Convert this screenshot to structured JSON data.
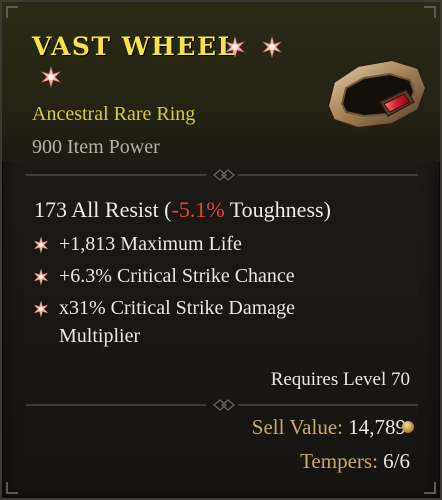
{
  "item": {
    "name": "VAST WHEEL",
    "type": "Ancestral Rare Ring",
    "item_power": "900 Item Power",
    "icon": "ring-icon"
  },
  "stats": {
    "resist_prefix": "173 All Resist (",
    "resist_delta": "-5.1%",
    "resist_suffix": " Toughness)",
    "affixes": [
      {
        "text": "+1,813 Maximum Life"
      },
      {
        "text": "+6.3% Critical Strike Chance"
      },
      {
        "text": "x31% Critical Strike Damage"
      },
      {
        "text": "Multiplier"
      }
    ]
  },
  "requirements": {
    "level": "Requires Level 70"
  },
  "footer": {
    "sell_label": "Sell Value:",
    "sell_value": "14,789",
    "tempers_label": "Tempers:",
    "tempers_value": "6/6"
  },
  "colors": {
    "title": "#f6e24a",
    "subtype": "#d7cc3d",
    "negative": "#e5453a",
    "label_gold": "#c8a96a"
  },
  "icons": [
    "star-icon",
    "bullet-star-icon",
    "divider-ornament-icon",
    "gold-coin-icon",
    "ring-icon"
  ]
}
